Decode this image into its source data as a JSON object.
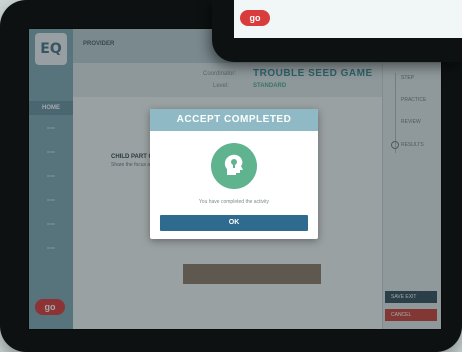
{
  "app": {
    "logo_text": "EQ",
    "brand_badge": "go",
    "page_tag": "PROVIDER"
  },
  "sidebar": {
    "active_item": "HOME",
    "brand_badge": "go"
  },
  "header": {
    "field1_label": "Coordinator:",
    "field1_value": "TROUBLE SEED GAME",
    "field2_label": "Level:",
    "field2_value": "STANDARD"
  },
  "content": {
    "title": "CHILD PART COMPLETE",
    "subtitle": "Share the focus area list"
  },
  "right_panel": {
    "items": [
      "STEP",
      "PRACTICE",
      "REVIEW",
      "RESULTS"
    ],
    "button_primary": "SAVE EXIT",
    "button_secondary": "CANCEL"
  },
  "modal": {
    "title": "ACCEPT COMPLETED",
    "message": "You have completed the activity",
    "ok_label": "OK",
    "icon": "silhouette-head-puzzle-icon"
  },
  "front_tablet": {
    "brand_badge": "go"
  },
  "colors": {
    "accent": "#8fb9c4",
    "primary_button": "#2f6b8e",
    "icon_green": "#5fb38f",
    "brand_red": "#d93c3c"
  }
}
